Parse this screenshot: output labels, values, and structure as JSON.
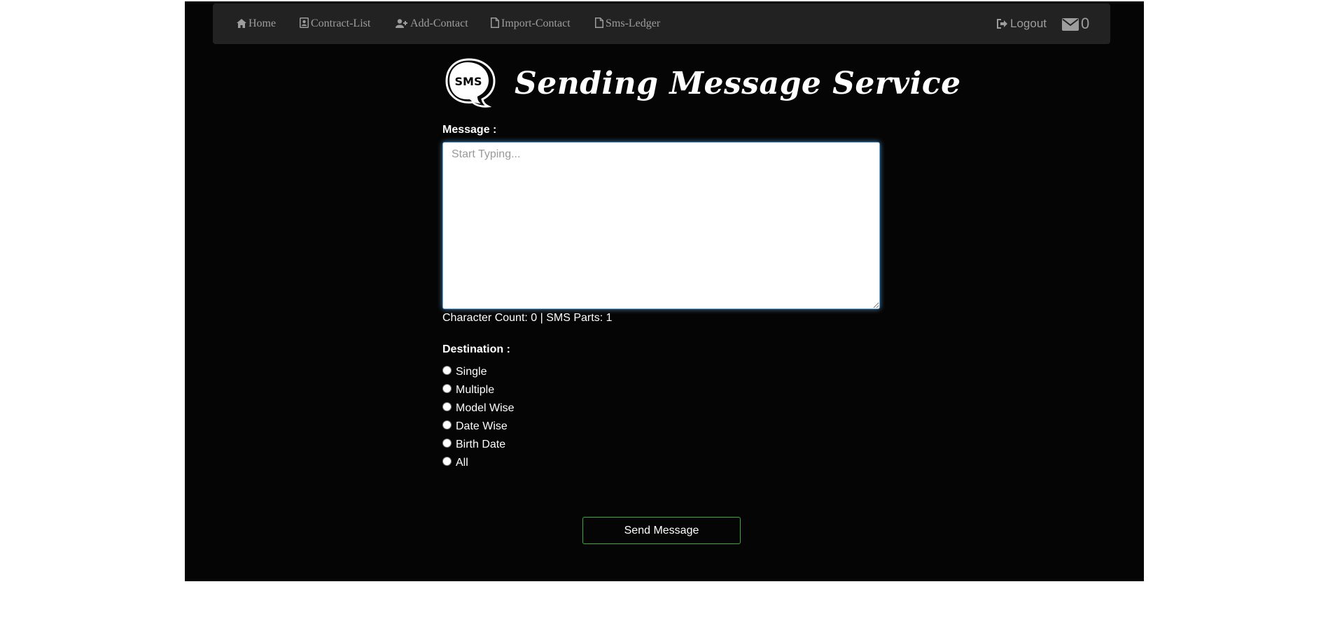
{
  "nav": {
    "home": "Home",
    "contract_list": "Contract-List",
    "add_contact": "Add-Contact",
    "import_contact": "Import-Contact",
    "sms_ledger": "Sms-Ledger",
    "logout": "Logout",
    "mail_count": "0"
  },
  "header": {
    "logo_text": "SMS",
    "title": "Sending Message Service"
  },
  "form": {
    "message_label": "Message :",
    "message_placeholder": "Start Typing...",
    "message_value": "",
    "char_count_text": "Character Count: 0 | SMS Parts: 1",
    "destination_label": "Destination :",
    "destinations": [
      "Single",
      "Multiple",
      "Model Wise",
      "Date Wise",
      "Birth Date",
      "All"
    ],
    "send_label": "Send Message"
  },
  "colors": {
    "page_bg": "#050505",
    "navbar_bg": "#222222",
    "nav_text": "#9d9d9d",
    "focus_glow": "#66afe9",
    "button_border": "#3aa83a"
  },
  "icons": [
    "home-icon",
    "contact-card-icon",
    "add-user-icon",
    "file-icon",
    "file-icon",
    "logout-icon",
    "envelope-icon"
  ]
}
